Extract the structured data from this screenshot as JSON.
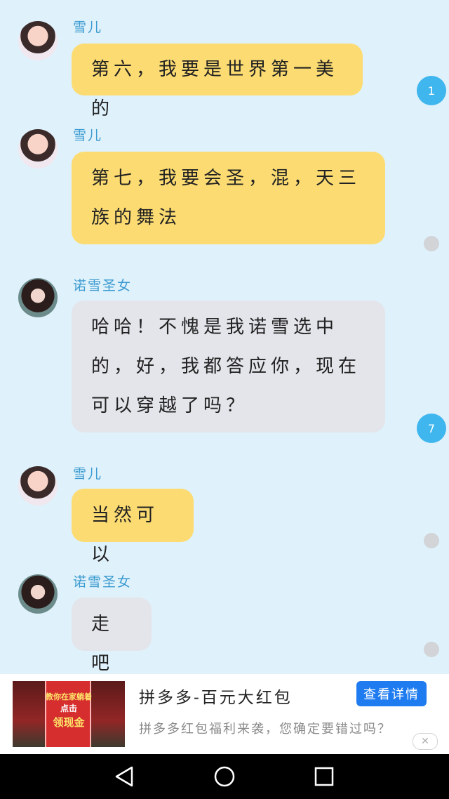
{
  "messages": [
    {
      "sender": "雪儿",
      "text": "第六，我要是世界第一美的"
    },
    {
      "sender": "雪儿",
      "text": "第七，我要会圣，混，天三族的舞法"
    },
    {
      "sender": "诺雪圣女",
      "text": "哈哈！不愧是我诺雪选中的，好，我都答应你，现在可以穿越了吗？"
    },
    {
      "sender": "雪儿",
      "text": "当然可以"
    },
    {
      "sender": "诺雪圣女",
      "text": "走吧"
    }
  ],
  "side_badges": [
    "1",
    "7"
  ],
  "ad": {
    "image_line1": "教你在家躺着",
    "image_line2": "点击",
    "image_line3": "领现金",
    "title": "拼多多-百元大红包",
    "description": "拼多多红包福利来袭，您确定要错过吗？",
    "button_label": "查看详情",
    "close_glyph": "✕"
  },
  "nav": {
    "back_icon": "back-triangle-icon",
    "home_icon": "home-circle-icon",
    "recent_icon": "recents-square-icon"
  }
}
